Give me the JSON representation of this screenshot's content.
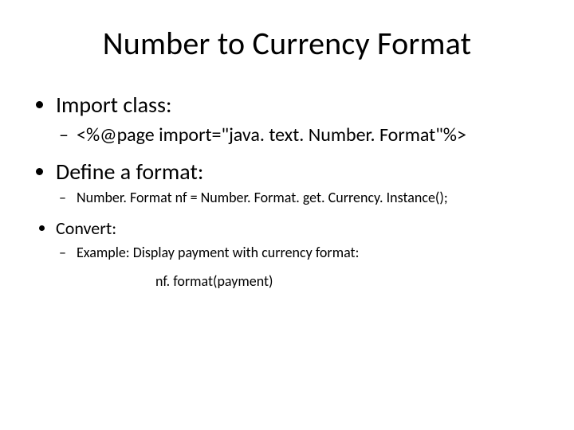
{
  "title": "Number to Currency Format",
  "items": {
    "import_class": {
      "label": "Import class:",
      "sub": "<%@page import=\"java. text. Number. Format\"%>"
    },
    "define_format": {
      "label": "Define a format:",
      "sub": "Number. Format nf = Number. Format. get. Currency. Instance();"
    },
    "convert": {
      "label": "Convert:",
      "sub": "Example: Display payment with currency format:",
      "sub2": "nf. format(payment)"
    }
  }
}
